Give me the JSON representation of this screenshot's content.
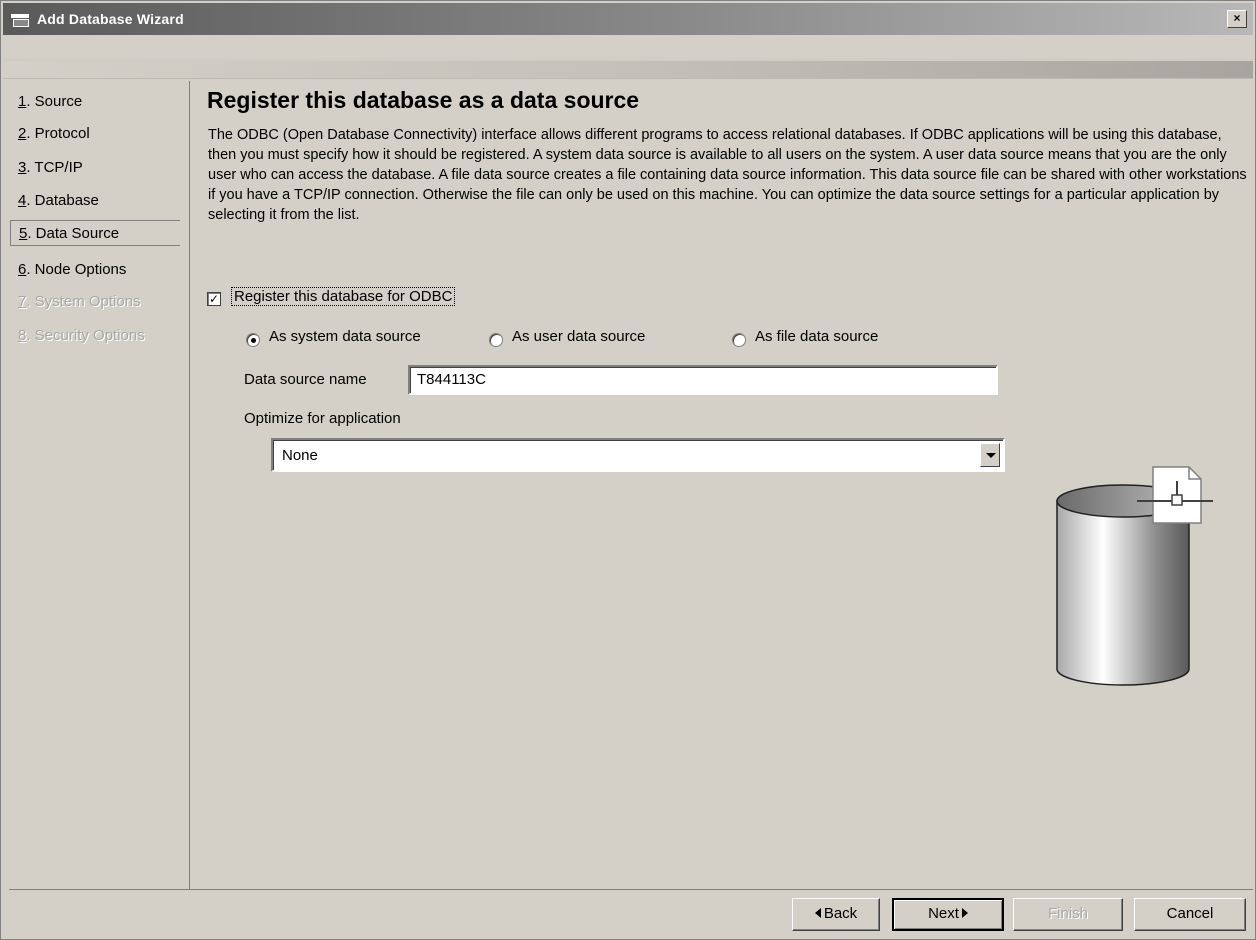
{
  "window": {
    "title": "Add Database Wizard",
    "close_glyph": "×"
  },
  "nav": {
    "items": [
      {
        "num": "1",
        "label": ". Source",
        "state": "enabled"
      },
      {
        "num": "2",
        "label": ". Protocol",
        "state": "enabled"
      },
      {
        "num": "3",
        "label": ". TCP/IP",
        "state": "enabled"
      },
      {
        "num": "4",
        "label": ". Database",
        "state": "enabled"
      },
      {
        "num": "5",
        "label": ". Data Source",
        "state": "selected"
      },
      {
        "num": "6",
        "label": ". Node Options",
        "state": "enabled"
      },
      {
        "num": "7",
        "label": ". System Options",
        "state": "disabled"
      },
      {
        "num": "8",
        "label": ". Security Options",
        "state": "disabled"
      }
    ]
  },
  "page": {
    "heading": "Register this database as a data source",
    "description": "The ODBC (Open Database Connectivity) interface allows different programs to access relational databases. If ODBC applications will be using this database, then you must specify how it should be registered. A system data source is available to all users on the system. A user data source means that you are the only user who can access the database. A file data source creates a file containing data source information. This data source file can be shared with other workstations if you have a TCP/IP connection. Otherwise the file can only be used on this machine. You can optimize the data source settings for a particular application by selecting it from the list."
  },
  "register": {
    "label": "Register this database for ODBC",
    "checked": true,
    "check_glyph": "✓"
  },
  "radios": [
    {
      "label": "As system data source",
      "selected": true
    },
    {
      "label": "As user data source",
      "selected": false
    },
    {
      "label": "As file data source",
      "selected": false
    }
  ],
  "fields": {
    "data_source_name_label": "Data source name",
    "data_source_name_value": "T844113C",
    "optimize_label": "Optimize for application",
    "optimize_selected": "None"
  },
  "buttons": {
    "back": "Back",
    "next": "Next",
    "finish": "Finish",
    "cancel": "Cancel"
  },
  "icons": {
    "illustration": "database-cylinder-icon",
    "file_connector": "file-connector-icon"
  },
  "colors": {
    "window_bg": "#d4d0c8",
    "titlebar_dark": "#5a5a5a",
    "disabled_text": "#a8a8a8"
  }
}
